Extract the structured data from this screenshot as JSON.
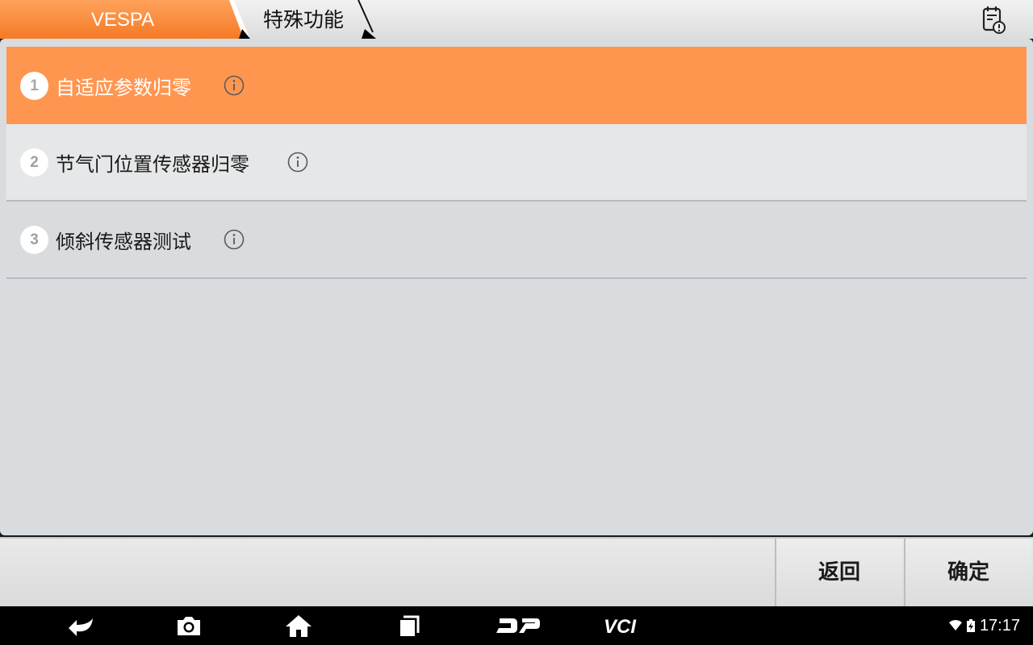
{
  "breadcrumb": {
    "items": [
      "VESPA",
      "特殊功能"
    ]
  },
  "menu": {
    "items": [
      {
        "number": "1",
        "label": "自适应参数归零",
        "selected": true
      },
      {
        "number": "2",
        "label": "节气门位置传感器归零",
        "selected": false
      },
      {
        "number": "3",
        "label": "倾斜传感器测试",
        "selected": false
      }
    ]
  },
  "actions": {
    "back_label": "返回",
    "confirm_label": "确定"
  },
  "system_bar": {
    "time": "17:17",
    "icons": [
      "back-icon",
      "camera-icon",
      "home-icon",
      "recents-icon",
      "dp-icon",
      "vci-icon"
    ]
  },
  "colors": {
    "accent": "#ff8a3d",
    "selected_row": "#ff9650",
    "panel": "#d8dcdf"
  }
}
